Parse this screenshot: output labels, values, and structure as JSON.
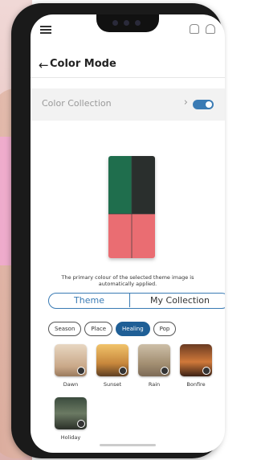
{
  "status_bar": {
    "menu_icon": "menu-icon",
    "right_icons": [
      "home-icon",
      "bell-icon"
    ]
  },
  "header": {
    "back_symbol": "←",
    "title": "Color Mode"
  },
  "color_collection": {
    "label": "Color Collection",
    "chevron": "›",
    "toggle_on": true
  },
  "caption": "The primary colour of the selected theme image is automatically applied.",
  "tabs": [
    {
      "label": "Theme",
      "selected": true
    },
    {
      "label": "My Collection",
      "selected": false
    }
  ],
  "filters": [
    {
      "label": "Season",
      "active": false
    },
    {
      "label": "Place",
      "active": false
    },
    {
      "label": "Healing",
      "active": true
    },
    {
      "label": "Pop",
      "active": false
    }
  ],
  "themes": [
    {
      "label": "Dawn",
      "color": "#d7c1a6"
    },
    {
      "label": "Sunset",
      "color": "#d9a050"
    },
    {
      "label": "Rain",
      "color": "#a89a84"
    },
    {
      "label": "Bonfire",
      "color": "#b35b2c"
    },
    {
      "label": "Holiday",
      "color": "#4a5a48"
    }
  ],
  "colors": {
    "accent": "#3a7bb4",
    "fridge_green": "#1f6e4d",
    "fridge_dark": "#2a2f2d",
    "fridge_pink": "#ea6d72"
  }
}
